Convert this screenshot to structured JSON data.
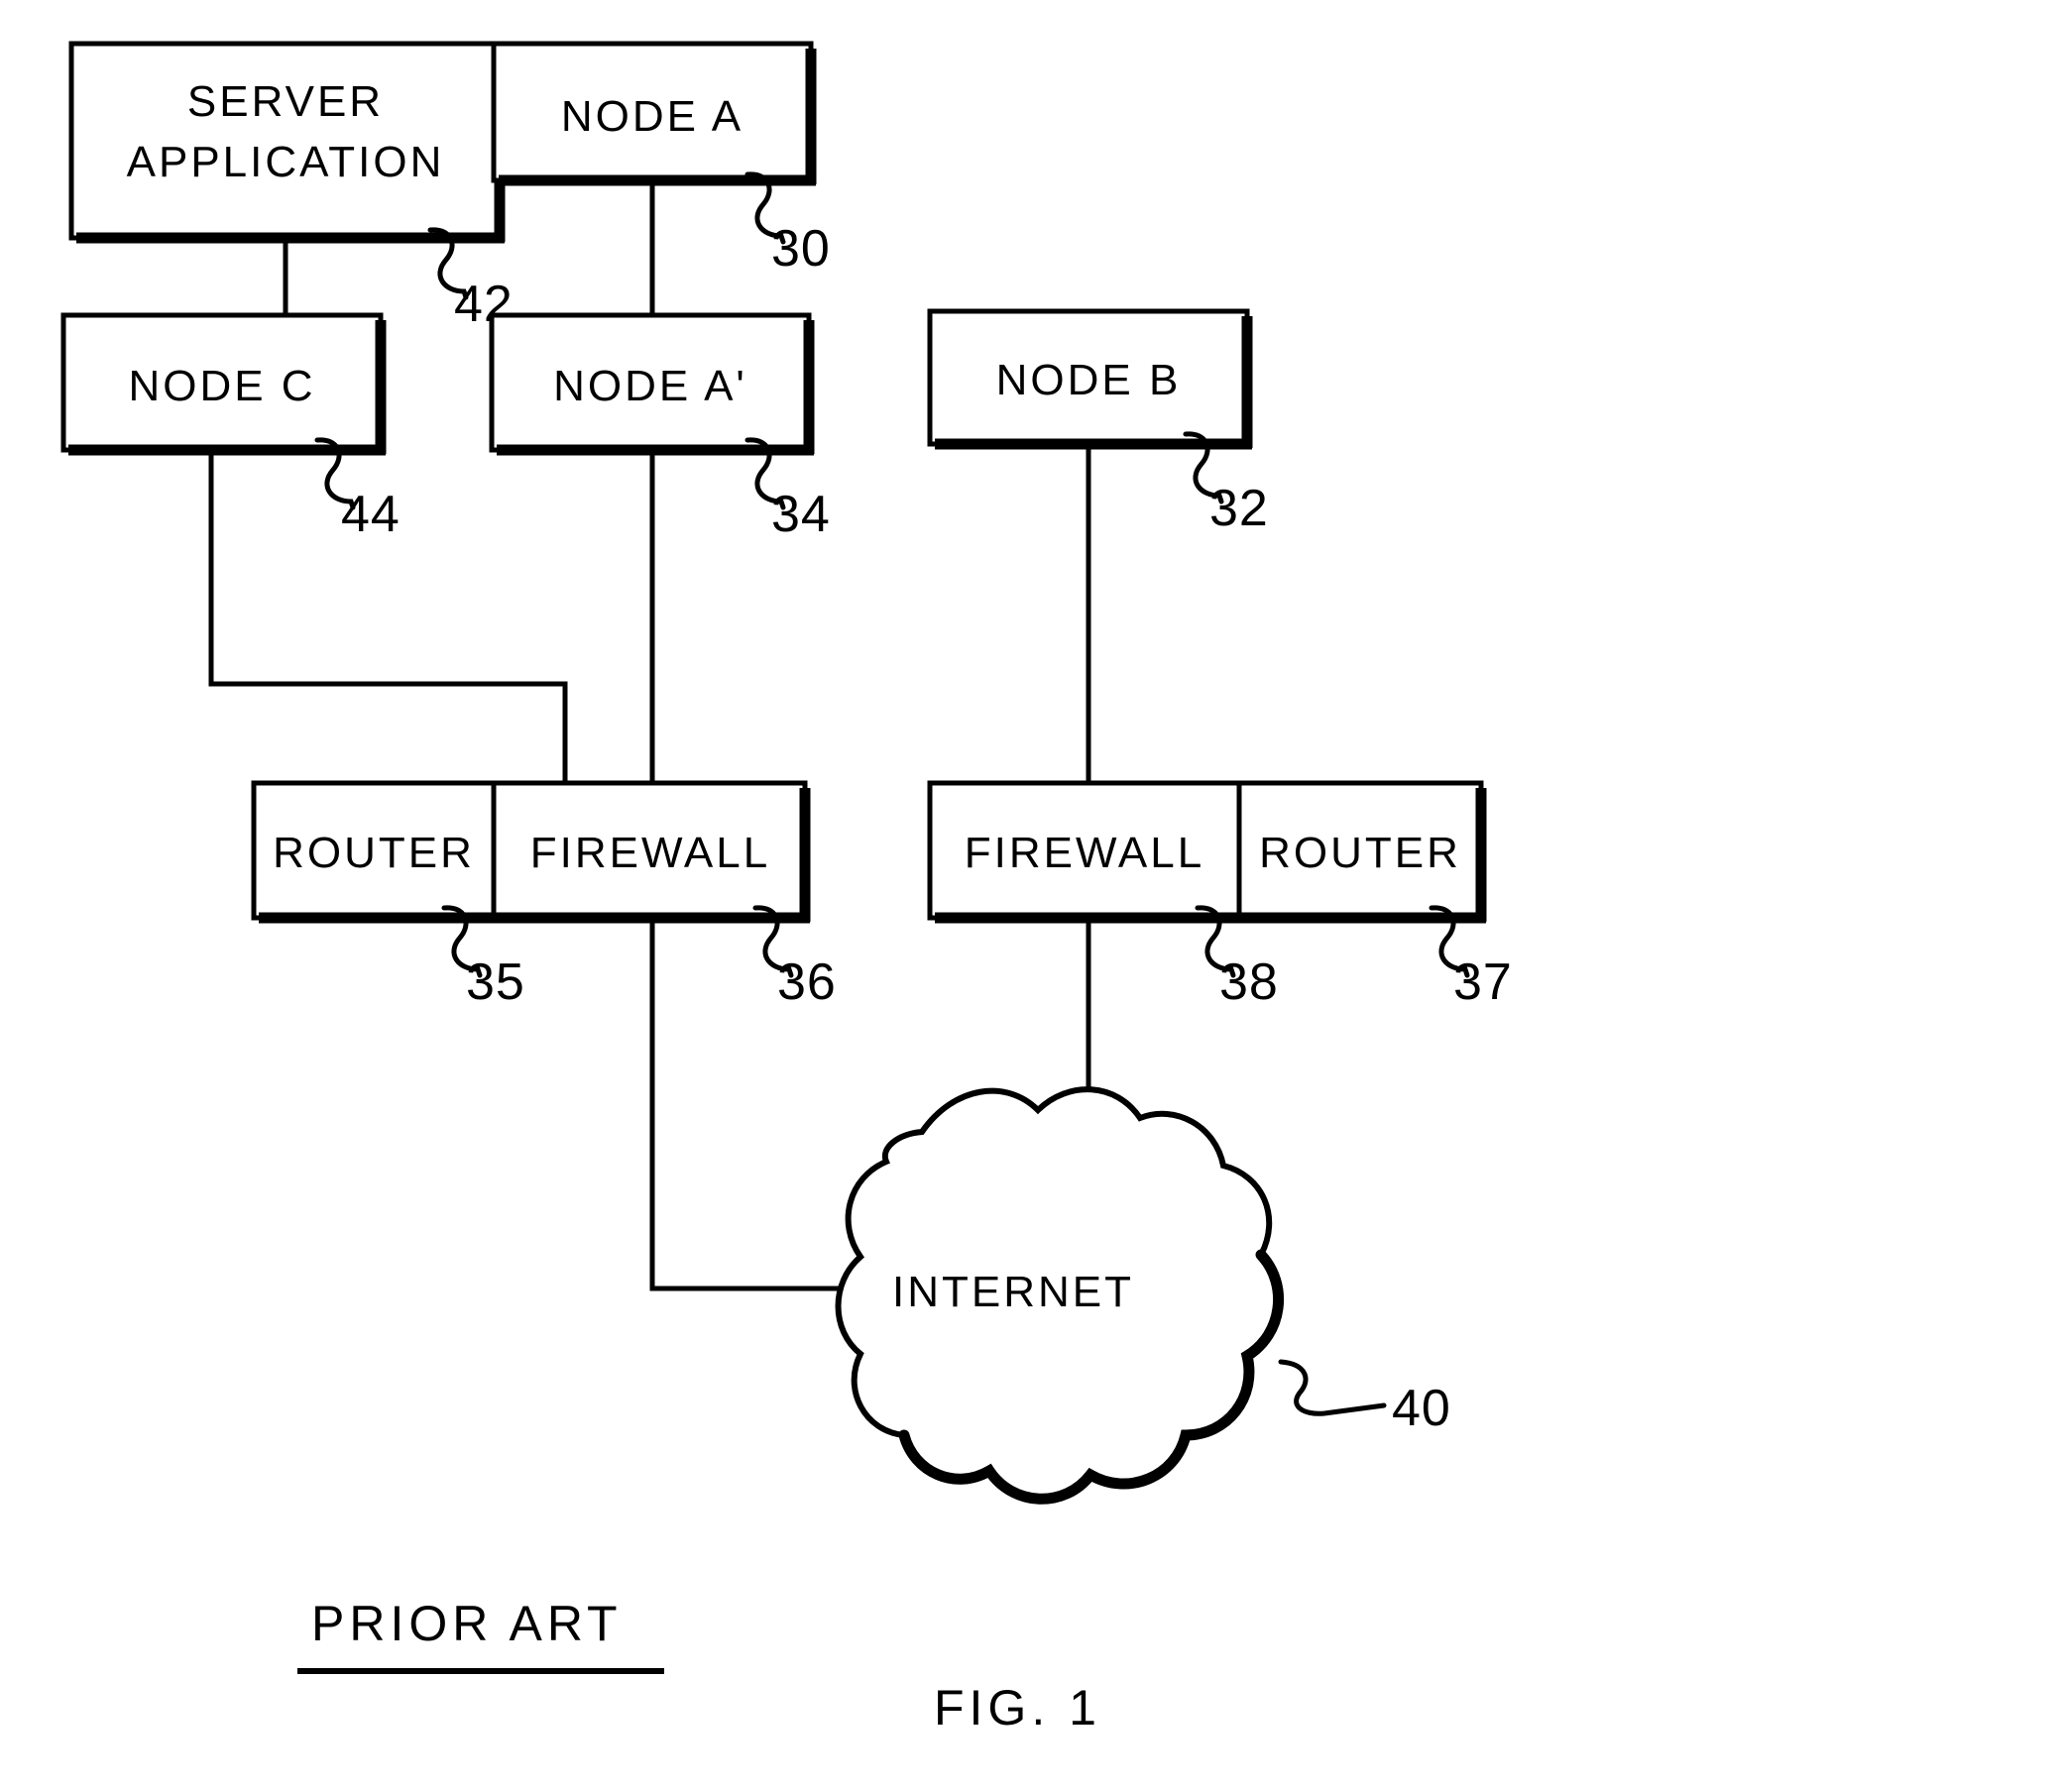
{
  "figure": {
    "caption": "FIG. 1",
    "prior_art_label": "PRIOR ART",
    "title": "Prior art network diagram with nodes, routers, firewalls and Internet"
  },
  "boxes": [
    {
      "id": "server-application",
      "label_line1": "SERVER",
      "label_line2": "APPLICATION",
      "ref": "42"
    },
    {
      "id": "node-a",
      "label": "NODE A",
      "ref": "30"
    },
    {
      "id": "node-c",
      "label": "NODE C",
      "ref": "44"
    },
    {
      "id": "node-a-prime",
      "label": "NODE A'",
      "ref": "34"
    },
    {
      "id": "node-b",
      "label": "NODE B",
      "ref": "32"
    },
    {
      "id": "router-left",
      "label": "ROUTER",
      "ref": "35"
    },
    {
      "id": "firewall-left",
      "label": "FIREWALL",
      "ref": "36"
    },
    {
      "id": "firewall-right",
      "label": "FIREWALL",
      "ref": "38"
    },
    {
      "id": "router-right",
      "label": "ROUTER",
      "ref": "37"
    }
  ],
  "cloud": {
    "label": "INTERNET",
    "ref": "40"
  },
  "colors": {
    "ink": "#000000",
    "paper": "#ffffff"
  }
}
